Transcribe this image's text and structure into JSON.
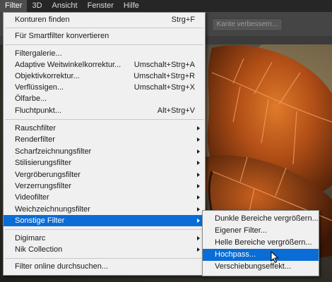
{
  "menubar": {
    "items": [
      {
        "label": "Filter",
        "active": true
      },
      {
        "label": "3D"
      },
      {
        "label": "Ansicht"
      },
      {
        "label": "Fenster"
      },
      {
        "label": "Hilfe"
      }
    ]
  },
  "optionsbar": {
    "refine_edge_label": "Kante verbessern..."
  },
  "filter_menu": {
    "items": [
      {
        "label": "Konturen finden",
        "shortcut": "Strg+F"
      },
      {
        "label": "Für Smartfilter konvertieren"
      },
      {
        "label": "Filtergalerie..."
      },
      {
        "label": "Adaptive Weitwinkelkorrektur...",
        "shortcut": "Umschalt+Strg+A"
      },
      {
        "label": "Objektivkorrektur...",
        "shortcut": "Umschalt+Strg+R"
      },
      {
        "label": "Verflüssigen...",
        "shortcut": "Umschalt+Strg+X"
      },
      {
        "label": "Ölfarbe..."
      },
      {
        "label": "Fluchtpunkt...",
        "shortcut": "Alt+Strg+V"
      },
      {
        "label": "Rauschfilter",
        "submenu": true
      },
      {
        "label": "Renderfilter",
        "submenu": true
      },
      {
        "label": "Scharfzeichnungsfilter",
        "submenu": true
      },
      {
        "label": "Stilisierungsfilter",
        "submenu": true
      },
      {
        "label": "Vergröberungsfilter",
        "submenu": true
      },
      {
        "label": "Verzerrungsfilter",
        "submenu": true
      },
      {
        "label": "Videofilter",
        "submenu": true
      },
      {
        "label": "Weichzeichnungsfilter",
        "submenu": true
      },
      {
        "label": "Sonstige Filter",
        "submenu": true,
        "highlighted": true
      },
      {
        "label": "Digimarc",
        "submenu": true
      },
      {
        "label": "Nik Collection",
        "submenu": true
      },
      {
        "label": "Filter online durchsuchen..."
      }
    ]
  },
  "other_submenu": {
    "items": [
      {
        "label": "Dunkle Bereiche vergrößern..."
      },
      {
        "label": "Eigener Filter..."
      },
      {
        "label": "Helle Bereiche vergrößern..."
      },
      {
        "label": "Hochpass...",
        "highlighted": true
      },
      {
        "label": "Verschiebungseffekt..."
      }
    ]
  },
  "colors": {
    "highlight": "#0a6dd6",
    "menu_bg": "#f0f0f0",
    "menubar_bg": "#262626"
  }
}
